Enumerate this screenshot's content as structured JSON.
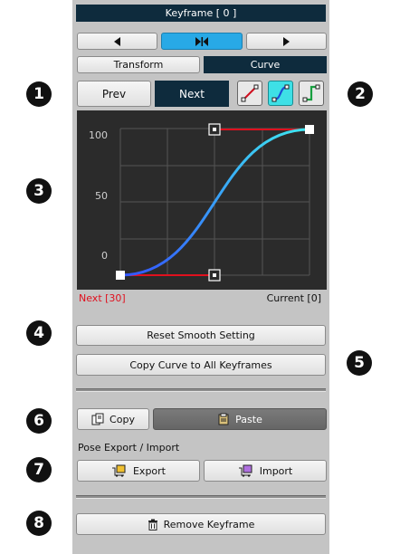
{
  "header": {
    "title": "Keyframe [ 0 ]"
  },
  "nav": {
    "prev_icon": "triangle-left-icon",
    "center_icon": "key-frame-center-icon",
    "next_icon": "triangle-right-icon"
  },
  "tabs": {
    "transform": "Transform",
    "curve": "Curve"
  },
  "target": {
    "prev": "Prev",
    "next": "Next"
  },
  "curve_types": [
    "linear-curve-icon",
    "smooth-curve-icon",
    "step-curve-icon"
  ],
  "graph": {
    "y_ticks": [
      "100",
      "50",
      "0"
    ],
    "status_left": "Next [30]",
    "status_right": "Current [0]",
    "colors": {
      "background": "#2b2b2b",
      "grid": "#555555",
      "handle_line": "#e0101e",
      "curve_start": "#3355ff",
      "curve_end": "#3ee6f0",
      "status_left": "#e0101e"
    }
  },
  "buttons": {
    "reset_smooth": "Reset Smooth Setting",
    "copy_curve": "Copy Curve to All Keyframes",
    "copy": "Copy",
    "paste": "Paste",
    "export": "Export",
    "import": "Import",
    "remove_keyframe": "Remove Keyframe"
  },
  "section": {
    "pose_export_import": "Pose Export / Import"
  },
  "markers": [
    "1",
    "2",
    "3",
    "4",
    "5",
    "6",
    "7",
    "8"
  ]
}
